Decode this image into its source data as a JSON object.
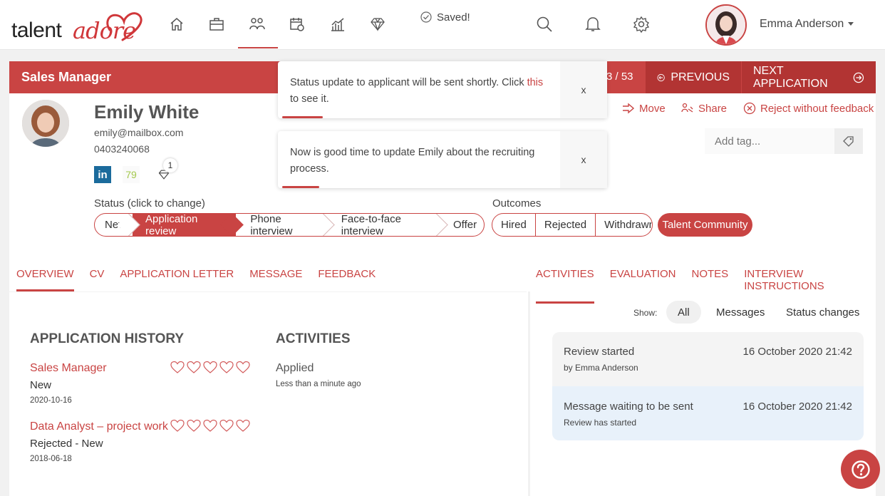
{
  "brand": {
    "part1": "talent",
    "part2": "adore"
  },
  "toasts": {
    "saved": "Saved!",
    "status_update_pre": "Status update to applicant will be sent shortly. Click ",
    "status_update_link": "this",
    "status_update_post": " to see it.",
    "reminder": "Now is good time to update Emily about the recruiting process.",
    "close": "x"
  },
  "user": {
    "name": "Emma Anderson"
  },
  "job": {
    "title": "Sales Manager",
    "counter": "3 / 53",
    "previous": "PREVIOUS",
    "next": "NEXT APPLICATION"
  },
  "applicant": {
    "name": "Emily White",
    "email": "emily@mailbox.com",
    "phone": "0403240068",
    "linkedin": "in",
    "score": "79",
    "diamond_count": "1"
  },
  "actions": {
    "move": "Move",
    "share": "Share",
    "reject": "Reject without feedback"
  },
  "tag": {
    "placeholder": "Add tag..."
  },
  "status": {
    "label": "Status (click to change)",
    "stages": [
      "New",
      "Application review",
      "Phone interview",
      "Face-to-face interview",
      "Offer"
    ],
    "outcomes_label": "Outcomes",
    "outcomes": [
      "Hired",
      "Rejected",
      "Withdrawn"
    ],
    "talent": "Talent Community"
  },
  "tabs_left": [
    "OVERVIEW",
    "CV",
    "APPLICATION LETTER",
    "MESSAGE",
    "FEEDBACK"
  ],
  "tabs_right": [
    "ACTIVITIES",
    "EVALUATION",
    "NOTES",
    "INTERVIEW INSTRUCTIONS"
  ],
  "history": {
    "heading": "APPLICATION HISTORY",
    "items": [
      {
        "title": "Sales Manager",
        "status": "New",
        "date": "2020-10-16"
      },
      {
        "title": "Data Analyst – project work",
        "status": "Rejected - New",
        "date": "2018-06-18"
      }
    ]
  },
  "activities": {
    "heading": "ACTIVITIES",
    "title": "Applied",
    "time": "Less than a minute ago"
  },
  "feed": {
    "show_label": "Show:",
    "filters": [
      "All",
      "Messages",
      "Status changes"
    ],
    "items": [
      {
        "title": "Review started",
        "sub": "by Emma Anderson",
        "date": "16 October 2020 21:42"
      },
      {
        "title": "Message waiting to be sent",
        "sub": "Review has started",
        "date": "16 October 2020 21:42"
      }
    ]
  },
  "colors": {
    "accent": "#c94443",
    "accent_dark": "#b23433",
    "highlight": "#e8f1fa"
  }
}
